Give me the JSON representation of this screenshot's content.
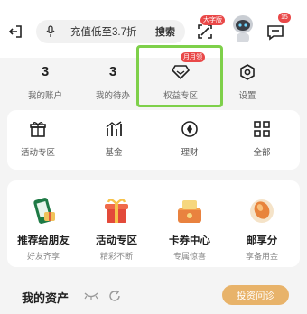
{
  "search": {
    "text": "充值低至3.7折",
    "button": "搜索"
  },
  "top_badges": {
    "scan": "大字版",
    "messages": "15"
  },
  "stats": [
    {
      "value": "3",
      "label": "我的账户"
    },
    {
      "value": "3",
      "label": "我的待办"
    },
    {
      "value": "",
      "label": "权益专区",
      "badge": "月月领"
    },
    {
      "value": "",
      "label": "设置"
    }
  ],
  "services": [
    {
      "label": "活动专区",
      "icon": "gift-icon"
    },
    {
      "label": "基金",
      "icon": "fund-chart-icon"
    },
    {
      "label": "理财",
      "icon": "coin-icon"
    },
    {
      "label": "全部",
      "icon": "grid-icon"
    }
  ],
  "promos": [
    {
      "title": "推荐给朋友",
      "subtitle": "好友齐享",
      "icon": "phone-gift-icon"
    },
    {
      "title": "活动专区",
      "subtitle": "精彩不断",
      "icon": "gift-box-icon"
    },
    {
      "title": "卡券中心",
      "subtitle": "专属惊喜",
      "icon": "coupon-box-icon"
    },
    {
      "title": "邮享分",
      "subtitle": "享备用金",
      "icon": "points-icon"
    }
  ],
  "assets": {
    "title": "我的资产",
    "invest_button": "投资问诊"
  },
  "colors": {
    "accent": "#7ed04a",
    "brand_green": "#1e7a45",
    "gold": "#e8b36a",
    "badge_red": "#e94848"
  }
}
